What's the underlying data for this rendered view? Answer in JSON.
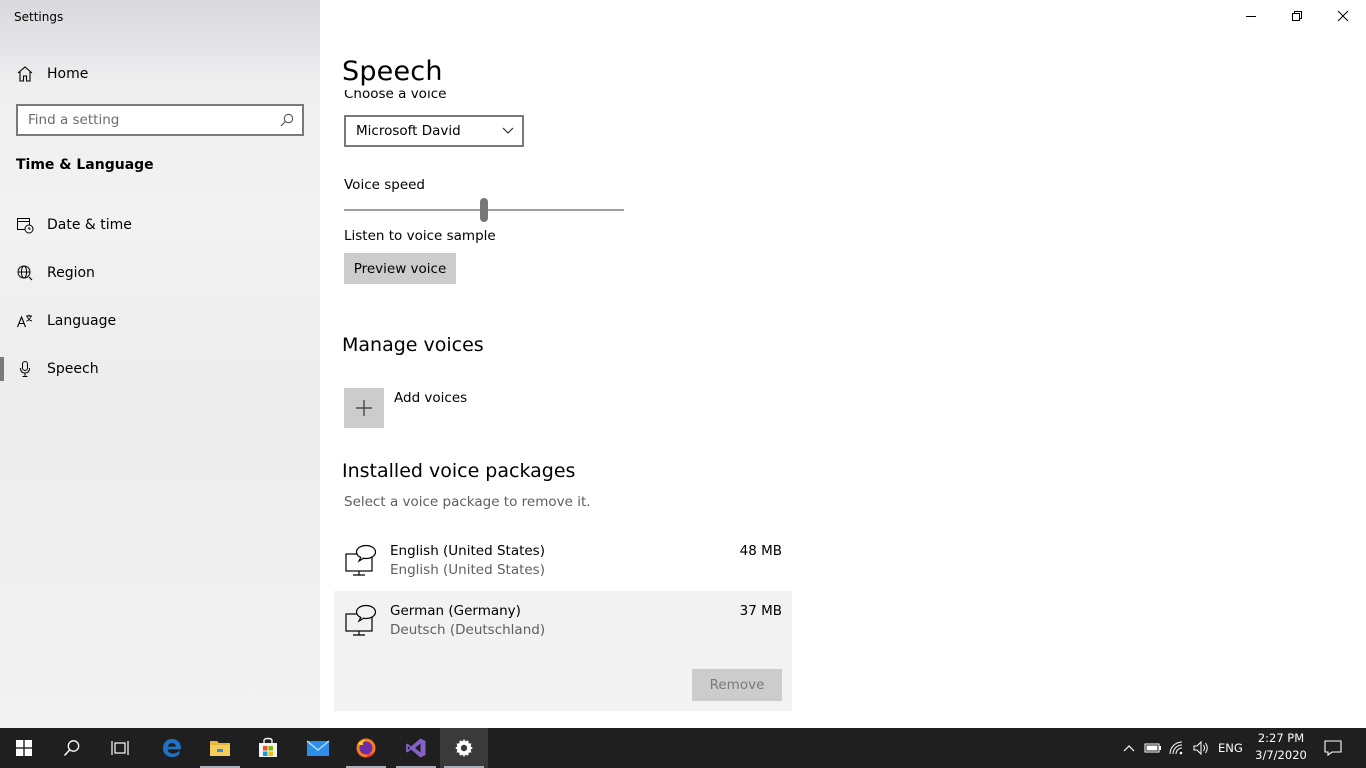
{
  "window": {
    "title": "Settings"
  },
  "sidebar": {
    "home_label": "Home",
    "search_placeholder": "Find a setting",
    "section_title": "Time & Language",
    "items": [
      {
        "label": "Date & time",
        "icon": "calendar-clock-icon"
      },
      {
        "label": "Region",
        "icon": "globe-icon"
      },
      {
        "label": "Language",
        "icon": "language-icon"
      },
      {
        "label": "Speech",
        "icon": "microphone-icon",
        "active": true
      }
    ]
  },
  "main": {
    "page_title": "Speech",
    "choose_voice_label": "Choose a voice",
    "voice_selected": "Microsoft David",
    "voice_speed_label": "Voice speed",
    "voice_speed_fraction": 0.5,
    "listen_label": "Listen to voice sample",
    "preview_button": "Preview voice",
    "manage_heading": "Manage voices",
    "add_voices_label": "Add voices",
    "installed_heading": "Installed voice packages",
    "installed_hint": "Select a voice package to remove it.",
    "packages": [
      {
        "name": "English (United States)",
        "native": "English (United States)",
        "size": "48 MB"
      },
      {
        "name": "German (Germany)",
        "native": "Deutsch (Deutschland)",
        "size": "37 MB",
        "selected": true
      }
    ],
    "remove_button": "Remove"
  },
  "taskbar": {
    "apps": [
      "start-icon",
      "search-icon",
      "task-view-icon",
      "edge-icon",
      "file-explorer-icon",
      "store-icon",
      "mail-icon",
      "firefox-icon",
      "visual-studio-icon",
      "settings-icon"
    ],
    "language": "ENG",
    "time": "2:27 PM",
    "date": "3/7/2020"
  },
  "colors": {
    "accent_gray": "#cccccc",
    "taskbar": "#1f1f1f",
    "edge_blue": "#1e73c7",
    "vs_purple": "#8661c5"
  }
}
